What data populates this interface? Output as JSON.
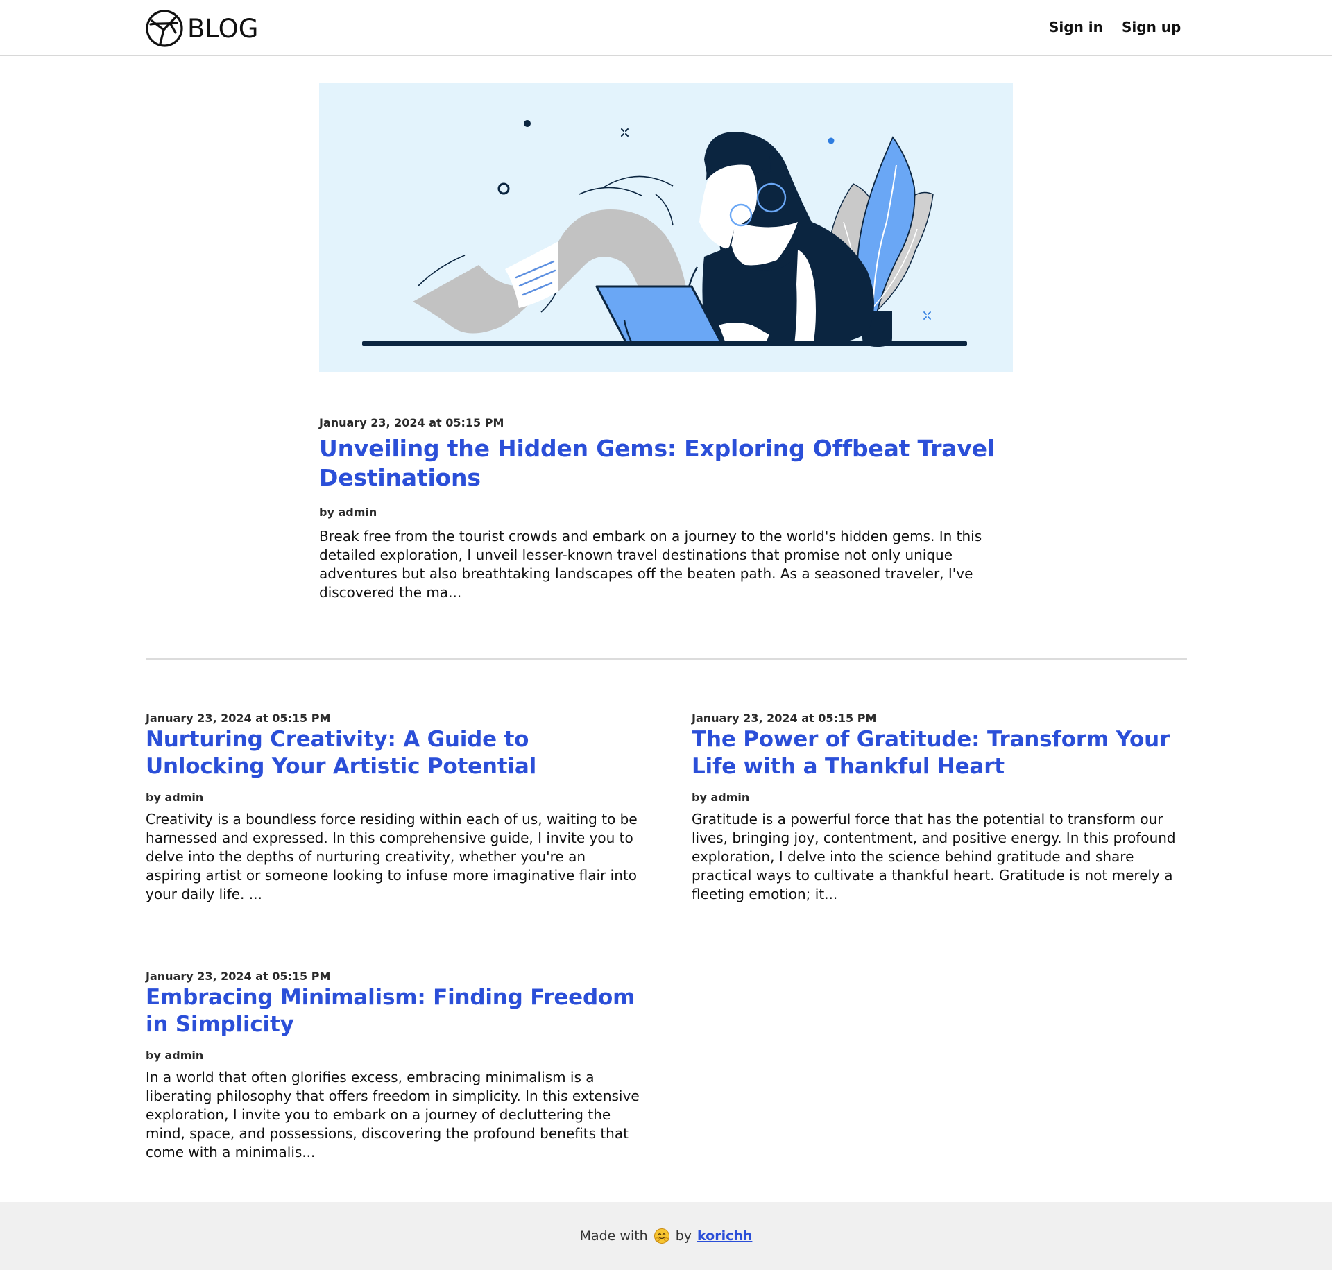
{
  "header": {
    "logo_text": "BLOG",
    "logo_icon": "plane-circle-icon",
    "nav": {
      "signin_label": "Sign in",
      "signup_label": "Sign up"
    }
  },
  "featured": {
    "date": "January 23, 2024 at 05:15 PM",
    "title": "Unveiling the Hidden Gems: Exploring Offbeat Travel Destinations",
    "author": "by admin",
    "excerpt": "Break free from the tourist crowds and embark on a journey to the world's hidden gems. In this detailed exploration, I unveil lesser-known travel destinations that promise not only unique adventures but also breathtaking landscapes off the beaten path. As a seasoned traveler, I've discovered the ma..."
  },
  "posts": [
    {
      "date": "January 23, 2024 at 05:15 PM",
      "title": "Nurturing Creativity: A Guide to Unlocking Your Artistic Potential",
      "author": "by admin",
      "excerpt": "Creativity is a boundless force residing within each of us, waiting to be harnessed and expressed. In this comprehensive guide, I invite you to delve into the depths of nurturing creativity, whether you're an aspiring artist or someone looking to infuse more imaginative flair into your daily life. ..."
    },
    {
      "date": "January 23, 2024 at 05:15 PM",
      "title": "The Power of Gratitude: Transform Your Life with a Thankful Heart",
      "author": "by admin",
      "excerpt": "Gratitude is a powerful force that has the potential to transform our lives, bringing joy, contentment, and positive energy. In this profound exploration, I delve into the science behind gratitude and share practical ways to cultivate a thankful heart. Gratitude is not merely a fleeting emotion; it..."
    },
    {
      "date": "January 23, 2024 at 05:15 PM",
      "title": "Embracing Minimalism: Finding Freedom in Simplicity",
      "author": "by admin",
      "excerpt": "In a world that often glorifies excess, embracing minimalism is a liberating philosophy that offers freedom in simplicity. In this extensive exploration, I invite you to embark on a journey of decluttering the mind, space, and possessions, discovering the profound benefits that come with a minimalis..."
    }
  ],
  "footer": {
    "made_with": "Made with",
    "emoji_icon": "hugging-face-icon",
    "by": "by",
    "author_link": "korichh"
  },
  "colors": {
    "title_blue": "#2b4fd8",
    "hero_bg": "#e3f3fc",
    "navy": "#0b2540",
    "accent_blue": "#6aa7f5",
    "paper_gray": "#c2c2c2",
    "footer_bg": "#f0f0f0"
  }
}
